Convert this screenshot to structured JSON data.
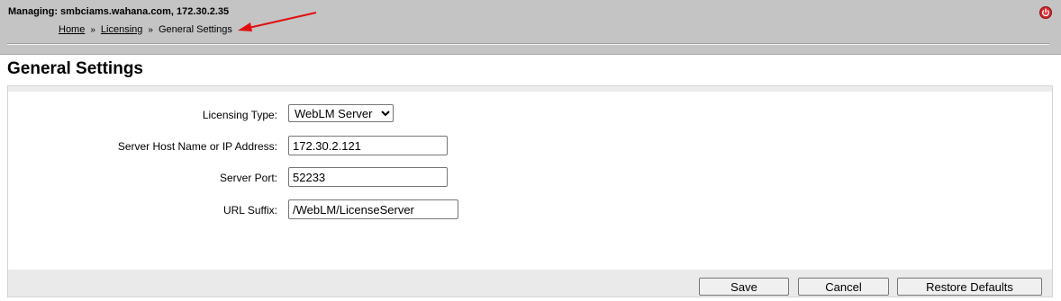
{
  "header": {
    "managing_text": "Managing: smbciams.wahana.com, 172.30.2.35",
    "breadcrumb": {
      "home": "Home",
      "licensing": "Licensing",
      "current": "General Settings",
      "separator": "»"
    }
  },
  "page": {
    "title": "General Settings"
  },
  "form": {
    "licensing_type": {
      "label": "Licensing Type:",
      "selected": "WebLM Server"
    },
    "server_host": {
      "label": "Server Host Name or IP Address:",
      "value": "172.30.2.121"
    },
    "server_port": {
      "label": "Server Port:",
      "value": "52233"
    },
    "url_suffix": {
      "label": "URL Suffix:",
      "value": "/WebLM/LicenseServer"
    }
  },
  "buttons": {
    "save": "Save",
    "cancel": "Cancel",
    "restore_defaults": "Restore Defaults"
  },
  "colors": {
    "header_bg": "#c4c4c4",
    "annotation_arrow": "#e01010",
    "power_icon": "#d9252a"
  },
  "icons": {
    "power": "power-icon",
    "annotation": "red-arrow-annotation"
  }
}
